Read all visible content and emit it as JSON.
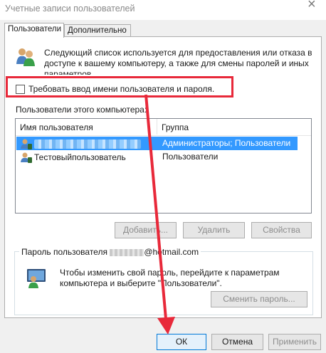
{
  "window": {
    "title": "Учетные записи пользователей",
    "close_glyph": "×"
  },
  "tabs": [
    {
      "label": "Пользователи"
    },
    {
      "label": "Дополнительно"
    }
  ],
  "intro_text": "Следующий список используется для предоставления или отказа в доступе к вашему компьютеру, а также для смены паролей и иных параметров.",
  "require_login": {
    "label": "Требовать ввод имени пользователя и пароля.",
    "checked": false
  },
  "users_label": "Пользователи этого компьютера:",
  "table": {
    "columns": [
      "Имя пользователя",
      "Группа"
    ],
    "rows": [
      {
        "name": "",
        "group": "Администраторы; Пользователи",
        "selected": true
      },
      {
        "name": "Тестовыйпользователь",
        "group": "Пользователи",
        "selected": false
      }
    ]
  },
  "user_buttons": {
    "add": "Добавить...",
    "remove": "Удалить",
    "properties": "Свойства"
  },
  "password_group": {
    "title_prefix": "Пароль пользователя",
    "title_suffix": "@hotmail.com",
    "text": "Чтобы изменить свой пароль, перейдите к параметрам компьютера и выберите \"Пользователи\".",
    "change_button": "Сменить пароль..."
  },
  "dialog_buttons": {
    "ok": "ОК",
    "cancel": "Отмена",
    "apply": "Применить"
  },
  "colors": {
    "annotation_red": "#e8293a",
    "selection_blue": "#3399ff",
    "focus_blue": "#0078d7"
  }
}
